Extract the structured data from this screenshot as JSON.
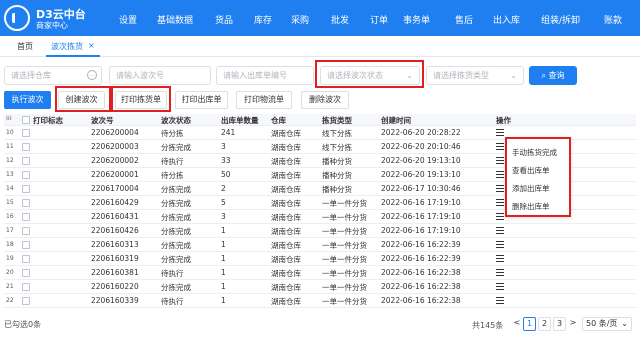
{
  "brand": {
    "line1": "D3云中台",
    "line2": "商家中心"
  },
  "nav": [
    "设置",
    "基础数据",
    "货品",
    "库存",
    "采购",
    "批发",
    "订单",
    "事务单",
    "售后",
    "出入库",
    "组装/拆卸",
    "账款"
  ],
  "tabs": [
    {
      "label": "首页"
    },
    {
      "label": "波次拣货",
      "close": "×"
    }
  ],
  "filters": {
    "warehouse": "请选择仓库",
    "wave_no": "请输入波次号",
    "outbound_no": "请输入出库单编号",
    "wave_status": "请选择波次状态",
    "pick_type": "请选择拣货类型",
    "query_label": "查询"
  },
  "actions": [
    "执行波次",
    "创建波次",
    "打印拣货单",
    "打印出库单",
    "打印物流单",
    "删除波次"
  ],
  "table": {
    "headers": [
      "打印标志",
      "波次号",
      "波次状态",
      "出库单数量",
      "仓库",
      "拣货类型",
      "创建时间",
      "操作"
    ],
    "rows": [
      {
        "n": "10",
        "wave": "2206200004",
        "status": "待分拣",
        "qty": "241",
        "wh": "湖南仓库",
        "type": "线下分拣",
        "time": "2022-06-20 20:28:22"
      },
      {
        "n": "11",
        "wave": "2206200003",
        "status": "分拣完成",
        "qty": "3",
        "wh": "湖南仓库",
        "type": "线下分拣",
        "time": "2022-06-20 20:10:46"
      },
      {
        "n": "12",
        "wave": "2206200002",
        "status": "待执行",
        "qty": "33",
        "wh": "湖南仓库",
        "type": "播种分货",
        "time": "2022-06-20 19:13:10"
      },
      {
        "n": "13",
        "wave": "2206200001",
        "status": "待分拣",
        "qty": "50",
        "wh": "湖南仓库",
        "type": "播种分货",
        "time": "2022-06-20 19:13:10"
      },
      {
        "n": "14",
        "wave": "2206170004",
        "status": "分拣完成",
        "qty": "2",
        "wh": "湖南仓库",
        "type": "播种分货",
        "time": "2022-06-17 10:30:46"
      },
      {
        "n": "15",
        "wave": "2206160429",
        "status": "分拣完成",
        "qty": "5",
        "wh": "湖南仓库",
        "type": "一单一件分货",
        "time": "2022-06-16 17:19:10"
      },
      {
        "n": "16",
        "wave": "2206160431",
        "status": "分拣完成",
        "qty": "3",
        "wh": "湖南仓库",
        "type": "一单一件分货",
        "time": "2022-06-16 17:19:10"
      },
      {
        "n": "17",
        "wave": "2206160426",
        "status": "分拣完成",
        "qty": "1",
        "wh": "湖南仓库",
        "type": "一单一件分货",
        "time": "2022-06-16 17:19:10"
      },
      {
        "n": "18",
        "wave": "2206160313",
        "status": "分拣完成",
        "qty": "1",
        "wh": "湖南仓库",
        "type": "一单一件分货",
        "time": "2022-06-16 16:22:39"
      },
      {
        "n": "19",
        "wave": "2206160319",
        "status": "分拣完成",
        "qty": "1",
        "wh": "湖南仓库",
        "type": "一单一件分货",
        "time": "2022-06-16 16:22:39"
      },
      {
        "n": "20",
        "wave": "2206160381",
        "status": "待执行",
        "qty": "1",
        "wh": "湖南仓库",
        "type": "一单一件分货",
        "time": "2022-06-16 16:22:38"
      },
      {
        "n": "21",
        "wave": "2206160220",
        "status": "分拣完成",
        "qty": "1",
        "wh": "湖南仓库",
        "type": "一单一件分货",
        "time": "2022-06-16 16:22:38"
      },
      {
        "n": "22",
        "wave": "2206160339",
        "status": "待执行",
        "qty": "1",
        "wh": "湖南仓库",
        "type": "一单一件分货",
        "time": "2022-06-16 16:22:38"
      }
    ]
  },
  "dropdown": [
    "手动拣货完成",
    "查看出库单",
    "添加出库单",
    "删除出库单"
  ],
  "footer": {
    "selected": "已勾选0条",
    "total": "共145条",
    "prev": "<",
    "pages": [
      "1",
      "2",
      "3"
    ],
    "next": ">",
    "page_size": "50 条/页"
  },
  "colors": {
    "brand": "#1f7ff0",
    "highlight": "#e02020"
  },
  "icons": {
    "logo": "d3-logo-icon",
    "menu": "menu-icon",
    "search": "search-icon",
    "dropdown": "chevron-down-icon",
    "clear": "clear-circle-icon",
    "close": "close-icon"
  }
}
